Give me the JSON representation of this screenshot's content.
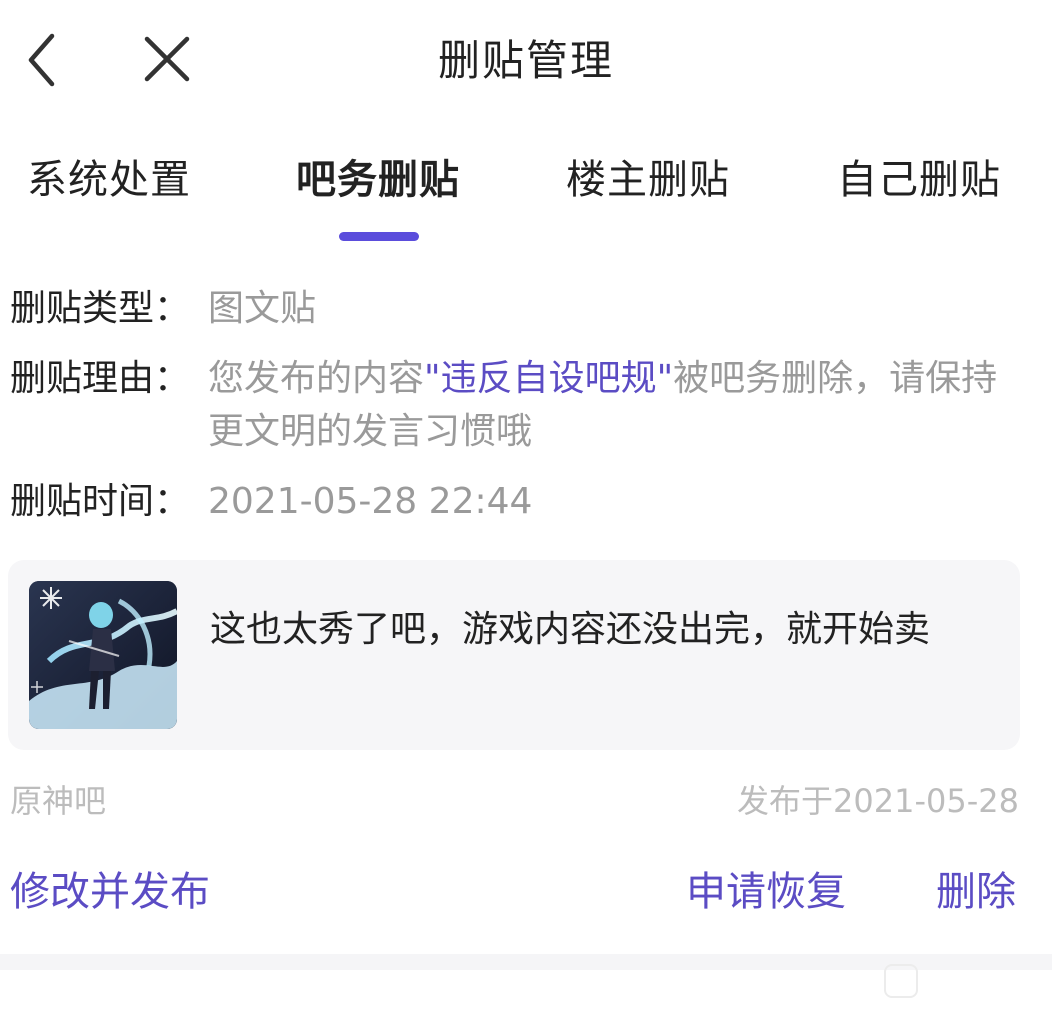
{
  "header": {
    "back_icon": "chevron-left-icon",
    "close_icon": "close-icon",
    "title": "删贴管理"
  },
  "tabs": [
    {
      "label": "系统处置",
      "active": false
    },
    {
      "label": "吧务删贴",
      "active": true
    },
    {
      "label": "楼主删贴",
      "active": false
    },
    {
      "label": "自己删贴",
      "active": false
    }
  ],
  "details": {
    "type_label": "删贴类型：",
    "type_value": "图文贴",
    "reason_label": "删贴理由：",
    "reason_prefix": "您发布的内容",
    "reason_highlight": "\"违反自设吧规\"",
    "reason_suffix": "被吧务删除，请保持更文明的发言习惯哦",
    "time_label": "删贴时间：",
    "time_value": "2021-05-28 22:44"
  },
  "post": {
    "text": "这也太秀了吧，游戏内容还没出完，就开始卖",
    "forum": "原神吧",
    "published": "发布于2021-05-28"
  },
  "actions": {
    "edit_publish": "修改并发布",
    "appeal": "申请恢复",
    "delete": "删除"
  },
  "colors": {
    "accent": "#5b4ddc",
    "link": "#5b4cc4",
    "muted": "#9a9a9a",
    "card_bg": "#f6f6f8"
  }
}
